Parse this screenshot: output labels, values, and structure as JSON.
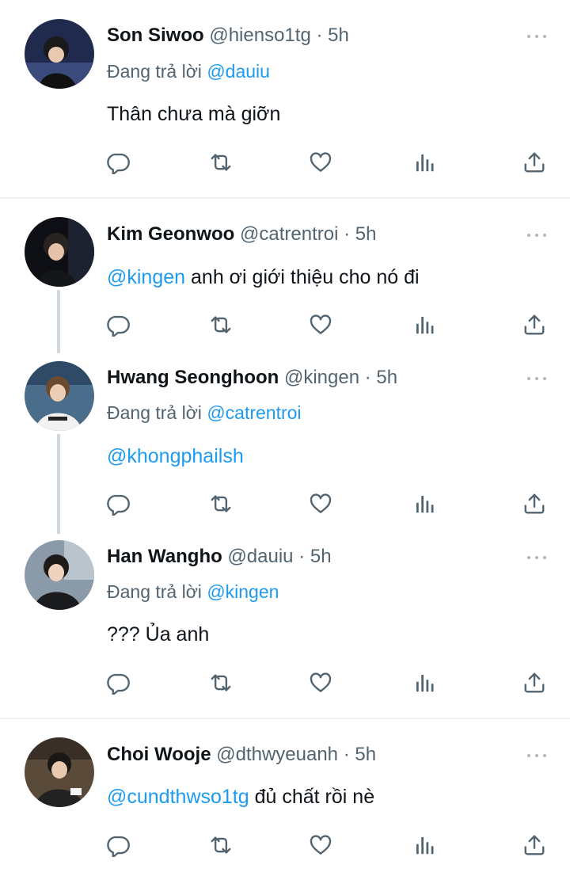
{
  "tweets": [
    {
      "name": "Son Siwoo",
      "handle": "@hienso1tg",
      "dot": "·",
      "time": "5h",
      "reply_prefix": "Đang trả lời",
      "reply_mention": "@dauiu",
      "text_mention": "",
      "text": "Thân chưa mà giỡn"
    },
    {
      "name": "Kim Geonwoo",
      "handle": "@catrentroi",
      "dot": "·",
      "time": "5h",
      "reply_prefix": "",
      "reply_mention": "",
      "text_mention": "@kingen",
      "text": " anh ơi giới thiệu cho nó đi"
    },
    {
      "name": "Hwang Seonghoon",
      "handle": "@kingen",
      "dot": "·",
      "time": "5h",
      "reply_prefix": "Đang trả lời",
      "reply_mention": "@catrentroi",
      "text_mention": "@khongphailsh",
      "text": ""
    },
    {
      "name": "Han Wangho",
      "handle": "@dauiu",
      "dot": "·",
      "time": "5h",
      "reply_prefix": "Đang trả lời",
      "reply_mention": "@kingen",
      "text_mention": "",
      "text": "??? Ủa anh"
    },
    {
      "name": "Choi Wooje",
      "handle": "@dthwyeuanh",
      "dot": "·",
      "time": "5h",
      "reply_prefix": "",
      "reply_mention": "",
      "text_mention": "@cundthwso1tg",
      "text": " đủ chất rồi nè"
    }
  ],
  "icons": {
    "reply": "reply-icon",
    "retweet": "retweet-icon",
    "like": "heart-icon",
    "views": "analytics-icon",
    "share": "share-icon",
    "more": "more-icon"
  },
  "colors": {
    "text": "#0f1419",
    "secondary": "#536471",
    "mention": "#1d9bf0",
    "thread_line": "#cfd9de",
    "separator": "#eff3f4"
  }
}
